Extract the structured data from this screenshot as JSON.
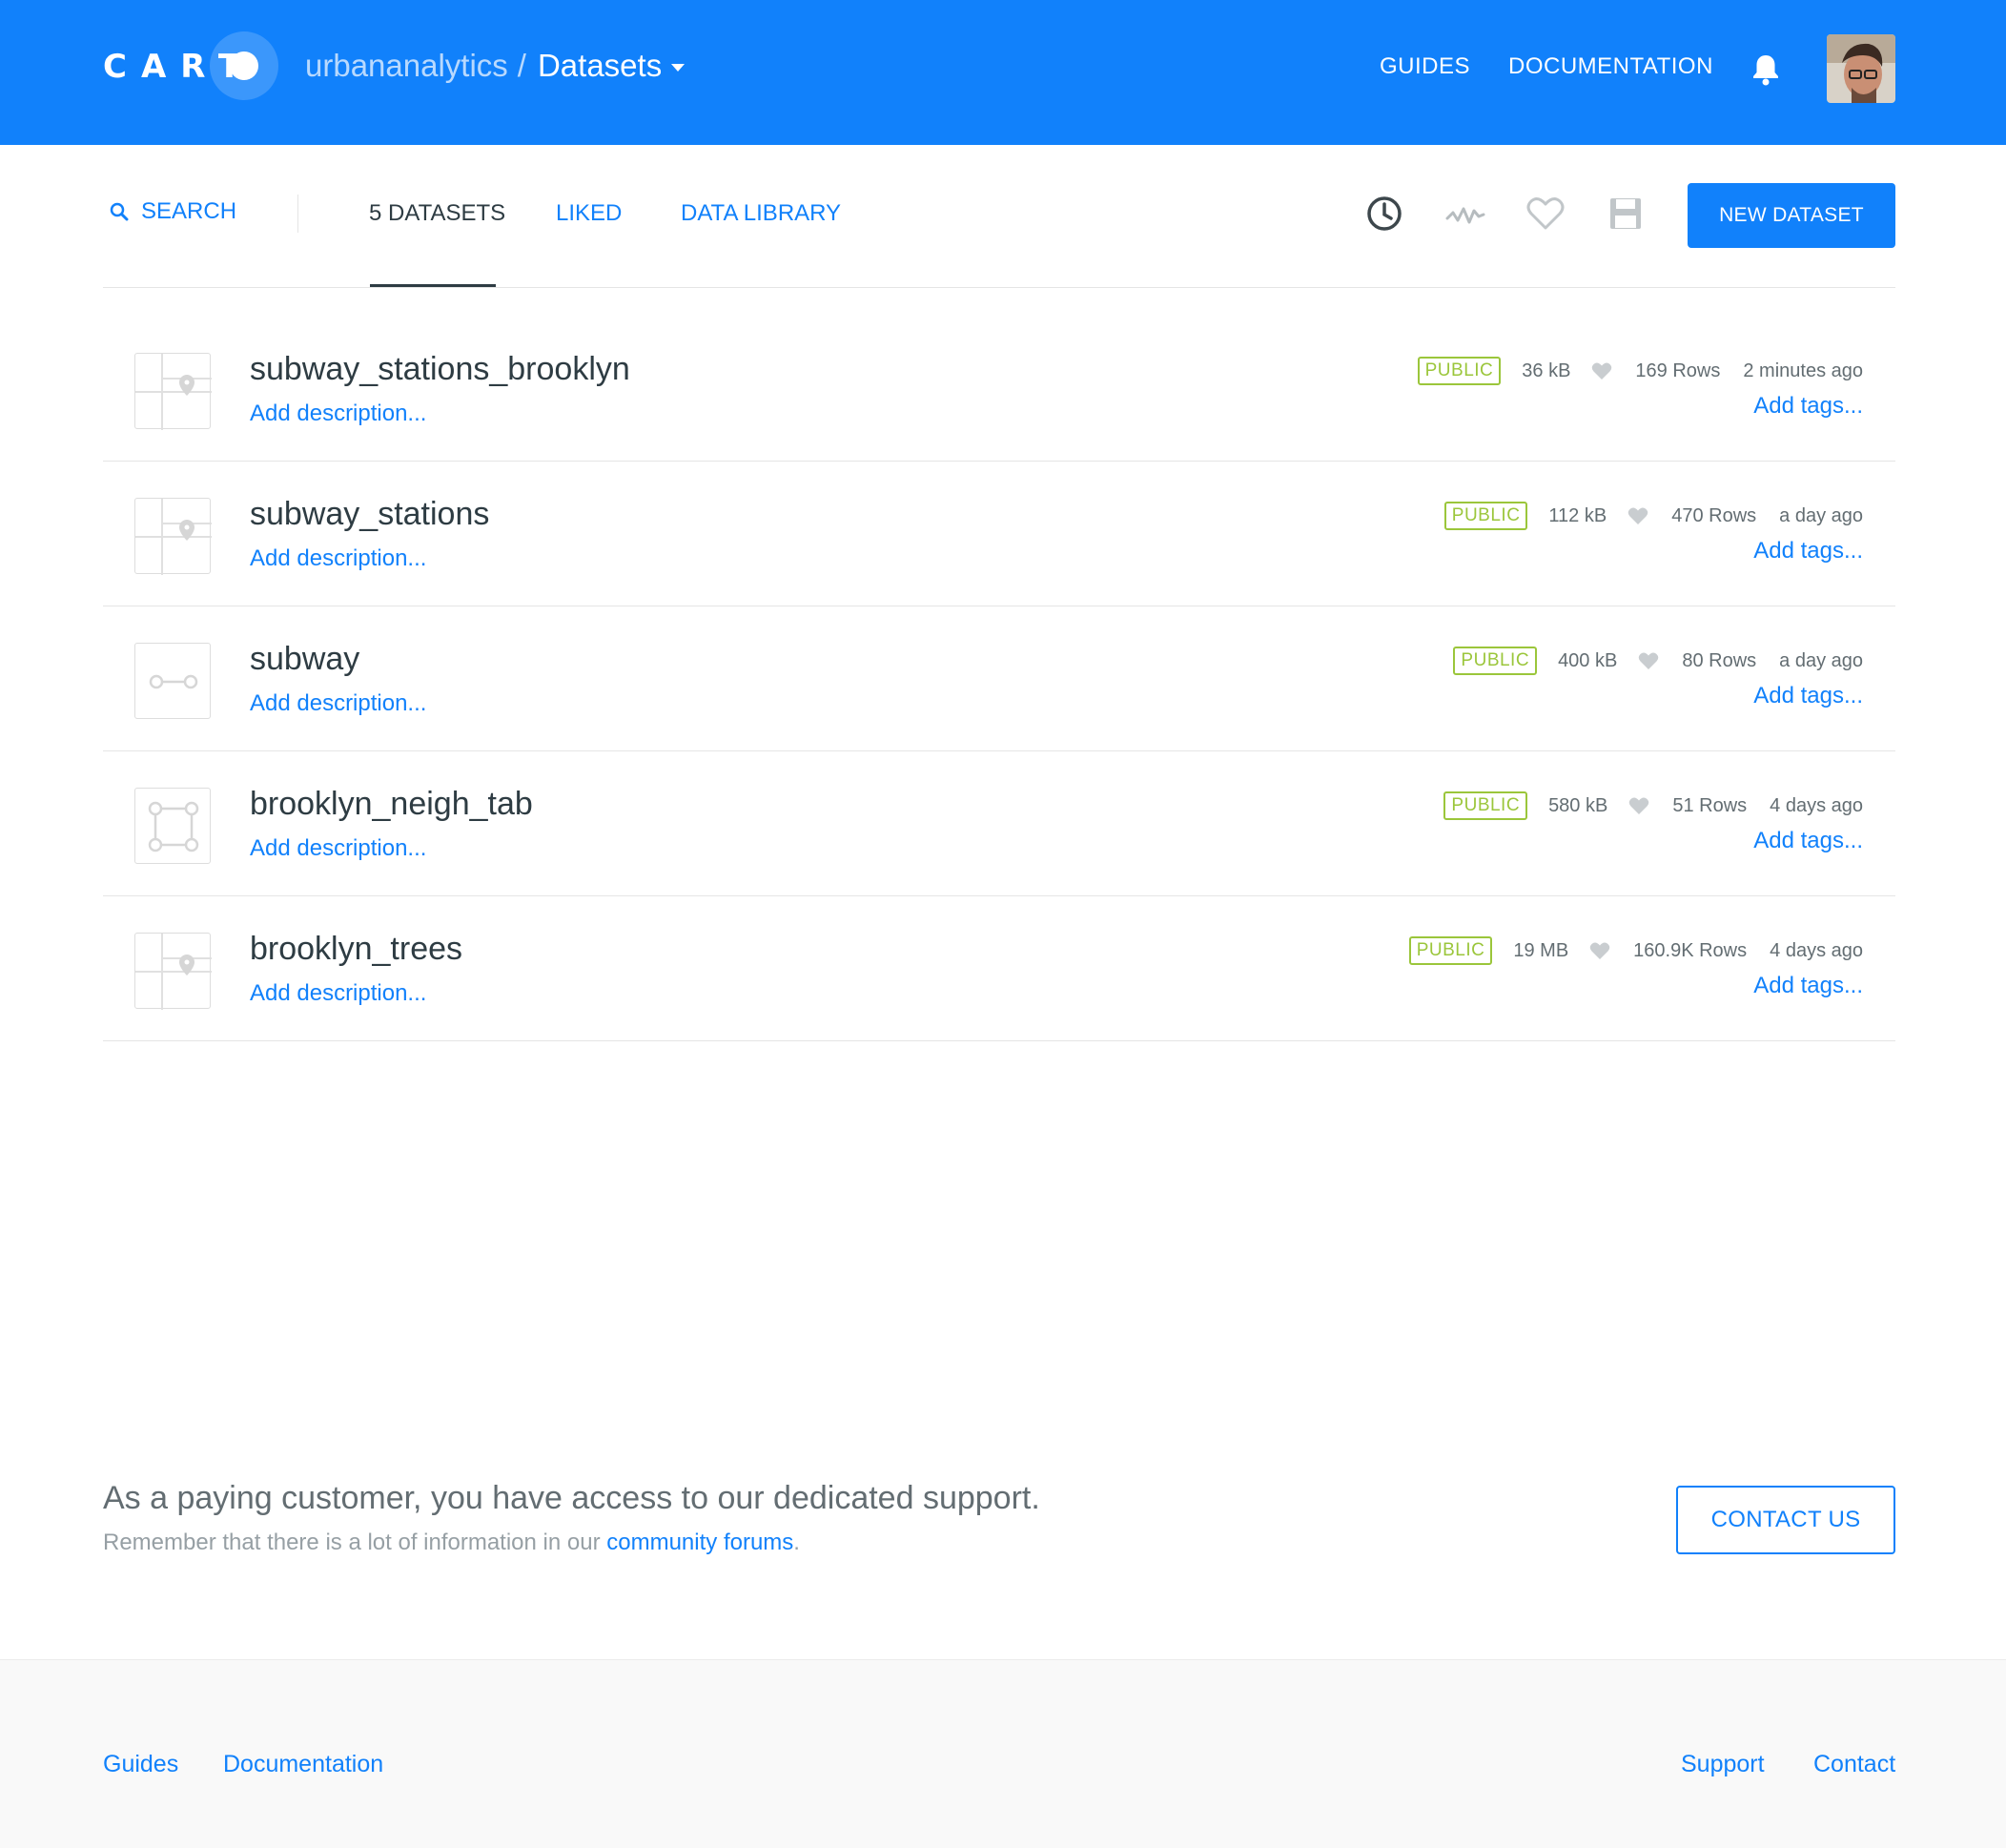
{
  "header": {
    "logo_text": "CART",
    "username": "urbananalytics",
    "separator": "/",
    "section": "Datasets",
    "links": [
      "GUIDES",
      "DOCUMENTATION"
    ],
    "icons": [
      "bell-icon",
      "avatar"
    ],
    "brand_color": "#1181fb"
  },
  "filters": {
    "search_label": "SEARCH",
    "tabs": [
      "5 DATASETS",
      "LIKED",
      "DATA LIBRARY"
    ],
    "active_tab": "5 DATASETS",
    "icons": [
      "clock-icon",
      "activity-icon",
      "heart-icon",
      "save-icon"
    ],
    "new_button": "NEW DATASET"
  },
  "datasets": [
    {
      "name": "subway_stations_brooklyn",
      "description": "Add description...",
      "privacy": "PUBLIC",
      "size": "36 kB",
      "rows": "169 Rows",
      "updated": "2 minutes ago",
      "tags": "Add tags...",
      "geometry": "point"
    },
    {
      "name": "subway_stations",
      "description": "Add description...",
      "privacy": "PUBLIC",
      "size": "112 kB",
      "rows": "470 Rows",
      "updated": "a day ago",
      "tags": "Add tags...",
      "geometry": "point"
    },
    {
      "name": "subway",
      "description": "Add description...",
      "privacy": "PUBLIC",
      "size": "400 kB",
      "rows": "80 Rows",
      "updated": "a day ago",
      "tags": "Add tags...",
      "geometry": "line"
    },
    {
      "name": "brooklyn_neigh_tab",
      "description": "Add description...",
      "privacy": "PUBLIC",
      "size": "580 kB",
      "rows": "51 Rows",
      "updated": "4 days ago",
      "tags": "Add tags...",
      "geometry": "polygon"
    },
    {
      "name": "brooklyn_trees",
      "description": "Add description...",
      "privacy": "PUBLIC",
      "size": "19 MB",
      "rows": "160.9K Rows",
      "updated": "4 days ago",
      "tags": "Add tags...",
      "geometry": "point"
    }
  ],
  "support": {
    "title": "As a paying customer, you have access to our dedicated support.",
    "subtitle_before": "Remember that there is a lot of information in our ",
    "subtitle_link": "community forums",
    "subtitle_after": ".",
    "contact_button": "CONTACT US"
  },
  "footer": {
    "left_links": [
      "Guides",
      "Documentation"
    ],
    "right_links": [
      "Support",
      "Contact"
    ]
  }
}
